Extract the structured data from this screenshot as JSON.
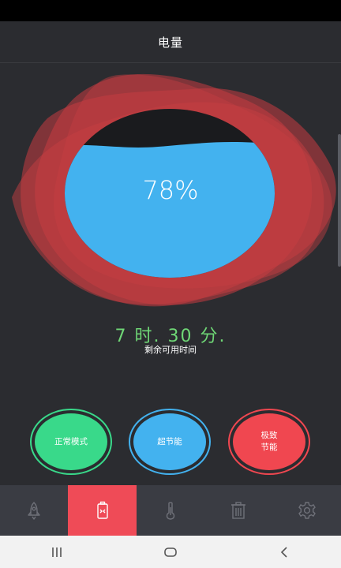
{
  "app": {
    "title": "电量"
  },
  "battery": {
    "level_percent": 78,
    "display": "78%"
  },
  "remaining": {
    "time": "7 时. 30 分.",
    "caption": "剩余可用时间"
  },
  "modes": [
    {
      "id": "normal",
      "label": "正常模式",
      "color": "#39d98a"
    },
    {
      "id": "super",
      "label": "超节能",
      "color": "#43b2ef"
    },
    {
      "id": "extreme",
      "label": "极致\n节能",
      "color": "#f04750"
    }
  ],
  "tabs": [
    {
      "icon": "rocket-icon",
      "active": false
    },
    {
      "icon": "battery-icon",
      "active": true
    },
    {
      "icon": "thermometer-icon",
      "active": false
    },
    {
      "icon": "trash-icon",
      "active": false
    },
    {
      "icon": "gear-icon",
      "active": false
    }
  ],
  "colors": {
    "background": "#2b2c30",
    "accent_red": "#ef4b57",
    "water_blue": "#43b2ef",
    "time_green": "#6fd776"
  },
  "navbar": [
    {
      "icon": "recent-apps-icon"
    },
    {
      "icon": "home-icon"
    },
    {
      "icon": "back-icon"
    }
  ]
}
